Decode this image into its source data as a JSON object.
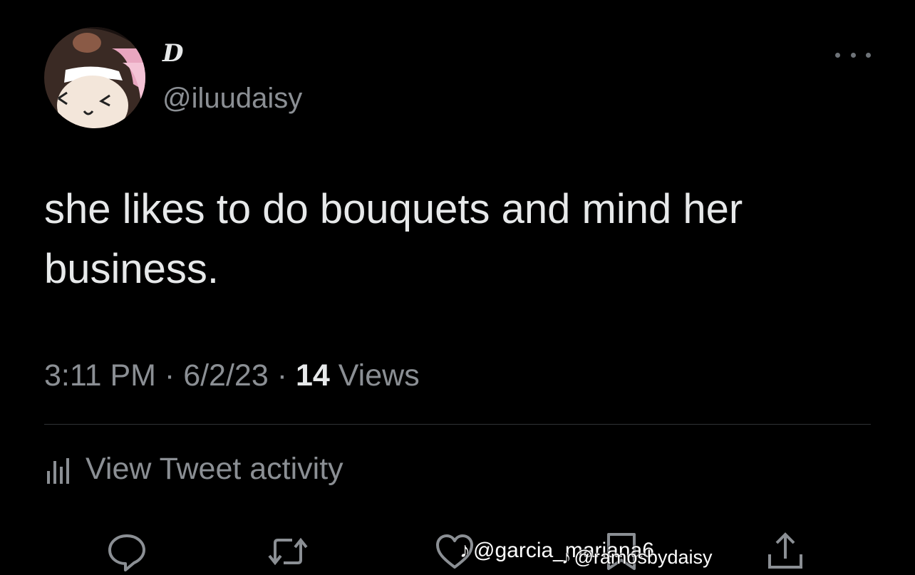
{
  "user": {
    "display_name": "D",
    "handle": "@iluudaisy",
    "avatar_icon": "avatar-photo"
  },
  "tweet": {
    "text": "she likes to do bouquets and mind her business.",
    "time": "3:11 PM",
    "separator": "·",
    "date": "6/2/23",
    "views_count": "14",
    "views_label": "Views"
  },
  "activity": {
    "label": "View Tweet activity",
    "icon": "bar-chart-icon"
  },
  "actions": [
    {
      "name": "reply",
      "icon": "reply-icon"
    },
    {
      "name": "retweet",
      "icon": "retweet-icon"
    },
    {
      "name": "like",
      "icon": "heart-icon"
    },
    {
      "name": "bookmark",
      "icon": "bookmark-icon"
    },
    {
      "name": "share",
      "icon": "share-icon"
    }
  ],
  "watermarks": {
    "first": "@garcia_mariana6",
    "second": "@ramosbydaisy",
    "tiktok_glyph": "♪"
  },
  "colors": {
    "background": "#000000",
    "primary_text": "#e7e9ea",
    "secondary_text": "#8b8f94",
    "divider": "#2f3336"
  }
}
